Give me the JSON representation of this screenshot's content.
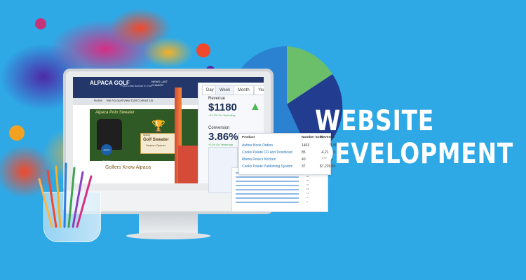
{
  "headline": {
    "line1": "WEBSITE",
    "line2": "DEVELOPMENT"
  },
  "monitor": {
    "site": {
      "logo": "ALPACA\nGOLF",
      "tagline": "Put A Little Animal In Your Game",
      "news_badge": "NEWS\nLAST CHANCE",
      "nav": [
        "Home",
        "My Account",
        "View Cart",
        "Contact Us"
      ],
      "hero_title": "Alpaca Polo Sweater",
      "hero_sign_small": "Spring",
      "hero_sign_big": "Golf Sweater",
      "hero_sign_sub": "Season Opener",
      "badge_label": "Alpaca Sweater",
      "section_title": "Golfers Know Alpaca"
    },
    "dashboard": {
      "tabs": [
        "Day",
        "Week",
        "Month",
        "Year"
      ],
      "revenue_label": "Revenue",
      "revenue_value": "$1180",
      "revenue_change": "+11.2% On Yesterday",
      "conversion_label": "Conversion",
      "conversion_value": "3.86%",
      "conversion_change": "+11% On Yesterday"
    }
  },
  "sales_table": {
    "headers": [
      "Product",
      "Number Sold",
      "Revenue"
    ],
    "rows": [
      {
        "product": "Author Book Orders",
        "sold": "1403",
        "revenue": "$11,641.55"
      },
      {
        "product": "Cooks Palate CD and Download",
        "sold": "85",
        "revenue": "$4,212.15"
      },
      {
        "product": "Mama Rose's Kitchen",
        "sold": "40",
        "revenue": "$170.00"
      },
      {
        "product": "Cooks Palate Publishing System",
        "sold": "37",
        "revenue": "$7,225.63"
      }
    ]
  },
  "secondary_table": {
    "rows": [
      "1403",
      "85",
      "40",
      "37",
      "18",
      "11",
      "8",
      "5"
    ]
  },
  "colors": {
    "background": "#2ea9e6",
    "pie_green": "#6bbf6a",
    "pie_navy": "#223d8f",
    "pie_blue": "#1d73c7",
    "headline_text": "#ffffff"
  },
  "icons": {
    "apple": "apple-logo-icon",
    "arrow_up": "arrow-up-icon"
  }
}
